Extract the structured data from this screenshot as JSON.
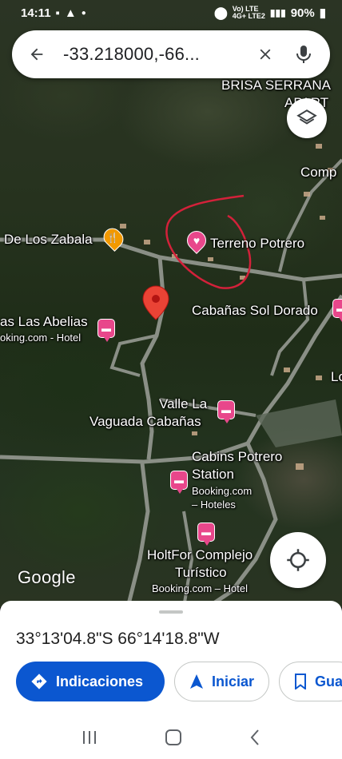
{
  "status_bar": {
    "time": "14:11",
    "network_top": "Vo) LTE",
    "network_bottom": "4G+ LTE2",
    "battery": "90%"
  },
  "search": {
    "query": "-33.218000,-66..."
  },
  "map": {
    "labels": {
      "brisa_serrana": "BRISA SERRANA",
      "apart": "APART",
      "comp": "Comp",
      "de_los_zabala": "De Los Zabala",
      "terreno_potrero": "Terreno Potrero",
      "cabanas_sol_dorado": "Cabañas Sol Dorado",
      "las_abelias_1": "as Las Abelias",
      "las_abelias_2": "oking.com - Hotel",
      "lo": "Lo",
      "valle_1": "Valle La",
      "valle_2": "Vaguada Cabañas",
      "cabins_1": "Cabins Potrero",
      "cabins_2": "Station",
      "cabins_3": "Booking.com",
      "cabins_4": "– Hoteles",
      "holtfor_1": "HoltFor Complejo",
      "holtfor_2": "Turístico",
      "holtfor_3": "Booking.com – Hotel"
    },
    "attribution": "Google",
    "colors": {
      "hotel_pin": "#e8478b",
      "restaurant_pin": "#f29900",
      "dropped_pin": "#ea4335",
      "annotation_circle": "#d3213a"
    }
  },
  "sheet": {
    "coordinates": "33°13'04.8\"S 66°14'18.8\"W",
    "actions": {
      "directions": "Indicaciones",
      "start": "Iniciar",
      "save": "Gua"
    },
    "colors": {
      "primary": "#0b57d0"
    }
  }
}
